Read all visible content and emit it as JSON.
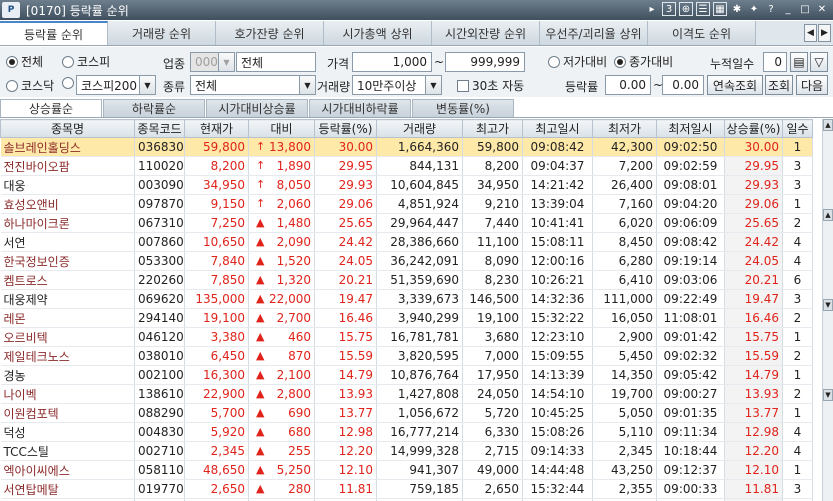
{
  "window": {
    "logo": "P",
    "title": "[0170] 등락률 순위",
    "page_num": "3"
  },
  "title_icons": [
    "nav-icon",
    "page-number-icon",
    "zoom-icon",
    "list-icon",
    "grid-icon",
    "pin-icon",
    "star-icon",
    "help-icon",
    "minimize-icon",
    "maximize-icon",
    "close-icon"
  ],
  "main_tabs": [
    "등락률 순위",
    "거래량 순위",
    "호가잔량 순위",
    "시가총액 상위",
    "시간외잔량 순위",
    "우선주/괴리율 상위",
    "이격도 순위"
  ],
  "filters": {
    "market_all": "전체",
    "market_kospi": "코스피",
    "market_kosdaq": "코스닥",
    "market_kospi200": "코스피200",
    "industry_label": "업종",
    "industry_code": "0000",
    "industry_value": "전체",
    "type_label": "종류",
    "type_value": "전체",
    "price_label": "가격",
    "price_min": "1,000",
    "price_tilde": "~",
    "price_max": "999,999",
    "volume_label": "거래량",
    "volume_value": "10만주이상",
    "auto_label": "30초 자동",
    "vs_low_label": "저가대비",
    "vs_close_label": "종가대비",
    "accum_days_label": "누적일수",
    "accum_days_value": "0",
    "rate_label": "등락률",
    "rate_min": "0.00",
    "rate_tilde": "~",
    "rate_max": "0.00",
    "continuous_btn": "연속조회",
    "query_btn": "조회",
    "next_btn": "다음"
  },
  "sub_tabs": [
    "상승률순",
    "하락률순",
    "시가대비상승률",
    "시가대비하락률",
    "변동률(%)"
  ],
  "table": {
    "headers": [
      "종목명",
      "종목코드",
      "현재가",
      "대비",
      "등락률(%)",
      "거래량",
      "최고가",
      "최고일시",
      "최저가",
      "최저일시",
      "상승률(%)",
      "일수"
    ],
    "rows": [
      [
        "솔브레인홀딩스",
        "036830",
        "59,800",
        "↑",
        "13,800",
        "30.00",
        "1,664,360",
        "59,800",
        "09:08:42",
        "42,300",
        "09:02:50",
        "30.00",
        "1"
      ],
      [
        "전진바이오팜",
        "110020",
        "8,200",
        "↑",
        "1,890",
        "29.95",
        "844,131",
        "8,200",
        "09:04:37",
        "7,200",
        "09:02:59",
        "29.95",
        "3"
      ],
      [
        "대웅",
        "003090",
        "34,950",
        "↑",
        "8,050",
        "29.93",
        "10,604,845",
        "34,950",
        "14:21:42",
        "26,400",
        "09:08:01",
        "29.93",
        "3"
      ],
      [
        "효성오앤비",
        "097870",
        "9,150",
        "↑",
        "2,060",
        "29.06",
        "4,851,924",
        "9,210",
        "13:39:04",
        "7,160",
        "09:04:20",
        "29.06",
        "1"
      ],
      [
        "하나마이크론",
        "067310",
        "7,250",
        "▲",
        "1,480",
        "25.65",
        "29,964,447",
        "7,440",
        "10:41:41",
        "6,020",
        "09:06:09",
        "25.65",
        "2"
      ],
      [
        "서연",
        "007860",
        "10,650",
        "▲",
        "2,090",
        "24.42",
        "28,386,660",
        "11,100",
        "15:08:11",
        "8,450",
        "09:08:42",
        "24.42",
        "4"
      ],
      [
        "한국정보인증",
        "053300",
        "7,840",
        "▲",
        "1,520",
        "24.05",
        "36,242,091",
        "8,090",
        "12:00:16",
        "6,280",
        "09:19:14",
        "24.05",
        "4"
      ],
      [
        "켐트로스",
        "220260",
        "7,850",
        "▲",
        "1,320",
        "20.21",
        "51,359,690",
        "8,230",
        "10:26:21",
        "6,410",
        "09:03:06",
        "20.21",
        "6"
      ],
      [
        "대웅제약",
        "069620",
        "135,000",
        "▲",
        "22,000",
        "19.47",
        "3,339,673",
        "146,500",
        "14:32:36",
        "111,000",
        "09:22:49",
        "19.47",
        "3"
      ],
      [
        "레몬",
        "294140",
        "19,100",
        "▲",
        "2,700",
        "16.46",
        "3,940,299",
        "19,100",
        "15:32:22",
        "16,050",
        "11:08:01",
        "16.46",
        "2"
      ],
      [
        "오르비텍",
        "046120",
        "3,380",
        "▲",
        "460",
        "15.75",
        "16,781,781",
        "3,680",
        "12:23:10",
        "2,900",
        "09:01:42",
        "15.75",
        "1"
      ],
      [
        "제일테크노스",
        "038010",
        "6,450",
        "▲",
        "870",
        "15.59",
        "3,820,595",
        "7,000",
        "15:09:55",
        "5,450",
        "09:02:32",
        "15.59",
        "2"
      ],
      [
        "경농",
        "002100",
        "16,300",
        "▲",
        "2,100",
        "14.79",
        "10,876,764",
        "17,950",
        "14:13:39",
        "14,350",
        "09:05:42",
        "14.79",
        "1"
      ],
      [
        "나이벡",
        "138610",
        "22,900",
        "▲",
        "2,800",
        "13.93",
        "1,427,808",
        "24,050",
        "14:54:10",
        "19,700",
        "09:00:27",
        "13.93",
        "2"
      ],
      [
        "이원컴포텍",
        "088290",
        "5,700",
        "▲",
        "690",
        "13.77",
        "1,056,672",
        "5,720",
        "10:45:25",
        "5,050",
        "09:01:35",
        "13.77",
        "1"
      ],
      [
        "덕성",
        "004830",
        "5,920",
        "▲",
        "680",
        "12.98",
        "16,777,214",
        "6,330",
        "15:08:26",
        "5,110",
        "09:11:34",
        "12.98",
        "4"
      ],
      [
        "TCC스틸",
        "002710",
        "2,345",
        "▲",
        "255",
        "12.20",
        "14,999,328",
        "2,715",
        "09:14:33",
        "2,345",
        "10:18:44",
        "12.20",
        "4"
      ],
      [
        "엑아이씨에스",
        "058110",
        "48,650",
        "▲",
        "5,250",
        "12.10",
        "941,307",
        "49,000",
        "14:44:48",
        "43,250",
        "09:12:37",
        "12.10",
        "1"
      ],
      [
        "서연탑메탈",
        "019770",
        "2,650",
        "▲",
        "280",
        "11.81",
        "759,185",
        "2,650",
        "15:32:44",
        "2,355",
        "09:00:33",
        "11.81",
        "3"
      ],
      [
        "씨젠",
        "096530",
        "310,600",
        "▲",
        "32,600",
        "11.73",
        "4,328,276",
        "314,500",
        "12:23:24",
        "280,700",
        "09:16:12",
        "11.73",
        "2"
      ]
    ],
    "name_colors": [
      "#8b2a2a",
      "#8b2a2a",
      "#222222",
      "#8b2a2a",
      "#8b2a2a",
      "#222222",
      "#8b2a2a",
      "#8b2a2a",
      "#222222",
      "#8b2a2a",
      "#8b2a2a",
      "#8b2a2a",
      "#222222",
      "#8b2a2a",
      "#8b2a2a",
      "#222222",
      "#222222",
      "#8b2a2a",
      "#8b2a2a",
      "#222222"
    ]
  },
  "colors": {
    "up": "#e0231b",
    "selected_row": "#ffe9a8",
    "accent": "#4a86c5"
  }
}
